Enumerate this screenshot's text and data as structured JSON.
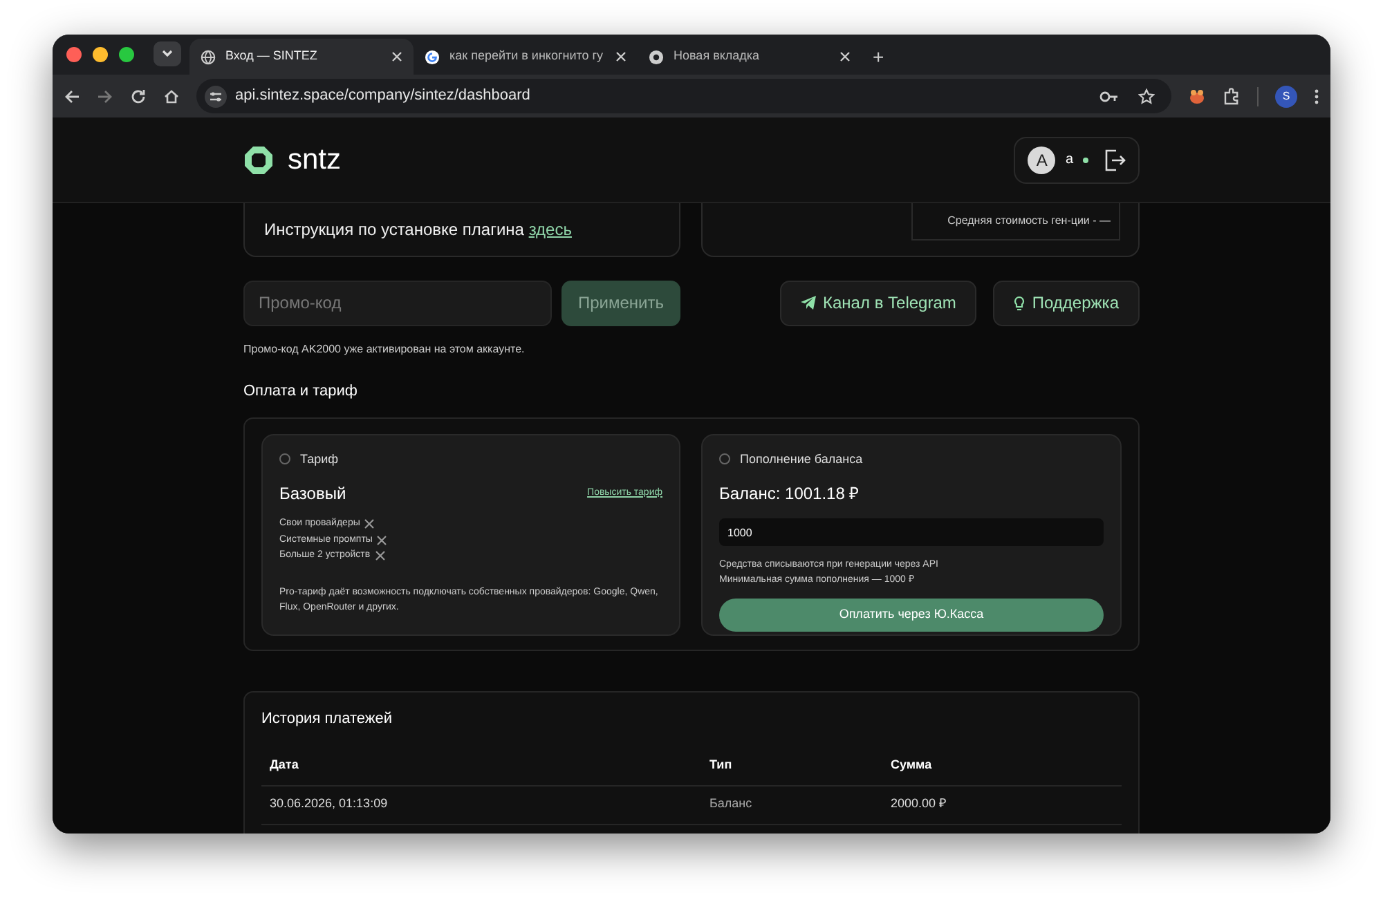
{
  "browser": {
    "tabs": [
      {
        "kind": "globe",
        "title": "Вход — SINTEZ",
        "selected": true
      },
      {
        "kind": "google",
        "title": "как перейти в инкогнито гу",
        "selected": false
      },
      {
        "kind": "chrome",
        "title": "Новая вкладка",
        "selected": false
      }
    ],
    "new_tab": "+",
    "url": "api.sintez.space/company/sintez/dashboard",
    "profile": "S"
  },
  "header": {
    "logo": "sntz",
    "avatar": "A",
    "user": "a",
    "online": true
  },
  "plugin_card": {
    "text": "Инструкция по установке плагина ",
    "link": "здесь"
  },
  "stats_card": {
    "line": "Средняя стоимость ген-ции - —"
  },
  "promo": {
    "placeholder": "Промо-код",
    "apply": "Применить",
    "apply_disabled": true,
    "note": "Промо-код AK2000 уже активирован на этом аккаунте."
  },
  "links": [
    {
      "kind": "telegram",
      "label": "Канал в Telegram"
    },
    {
      "kind": "support",
      "label": "Поддержка"
    }
  ],
  "billing": {
    "title": "Оплата и тариф",
    "plan": {
      "heading": "Тариф",
      "name": "Базовый",
      "upgrade": "Повысить тариф",
      "features": [
        {
          "label": "Свои провайдеры",
          "included": false
        },
        {
          "label": "Системные промпты",
          "included": false
        },
        {
          "label": "Больше 2 устройств",
          "included": false
        }
      ],
      "note": "Pro-тариф даёт возможность подключать собственных провайдеров: Google, Qwen, Flux, OpenRouter и других."
    },
    "topup": {
      "heading": "Пополнение баланса",
      "balance": "Баланс: 1001.18 ₽",
      "amount": "1000",
      "notes": [
        "Средства списываются при генерации через API",
        "Минимальная сумма пополнения — 1000 ₽"
      ],
      "pay": "Оплатить через Ю.Касса"
    }
  },
  "history": {
    "title": "История платежей",
    "columns": [
      "Дата",
      "Тип",
      "Сумма"
    ],
    "rows": [
      [
        "30.06.2026, 01:13:09",
        "Баланс",
        "2000.00 ₽"
      ]
    ]
  }
}
